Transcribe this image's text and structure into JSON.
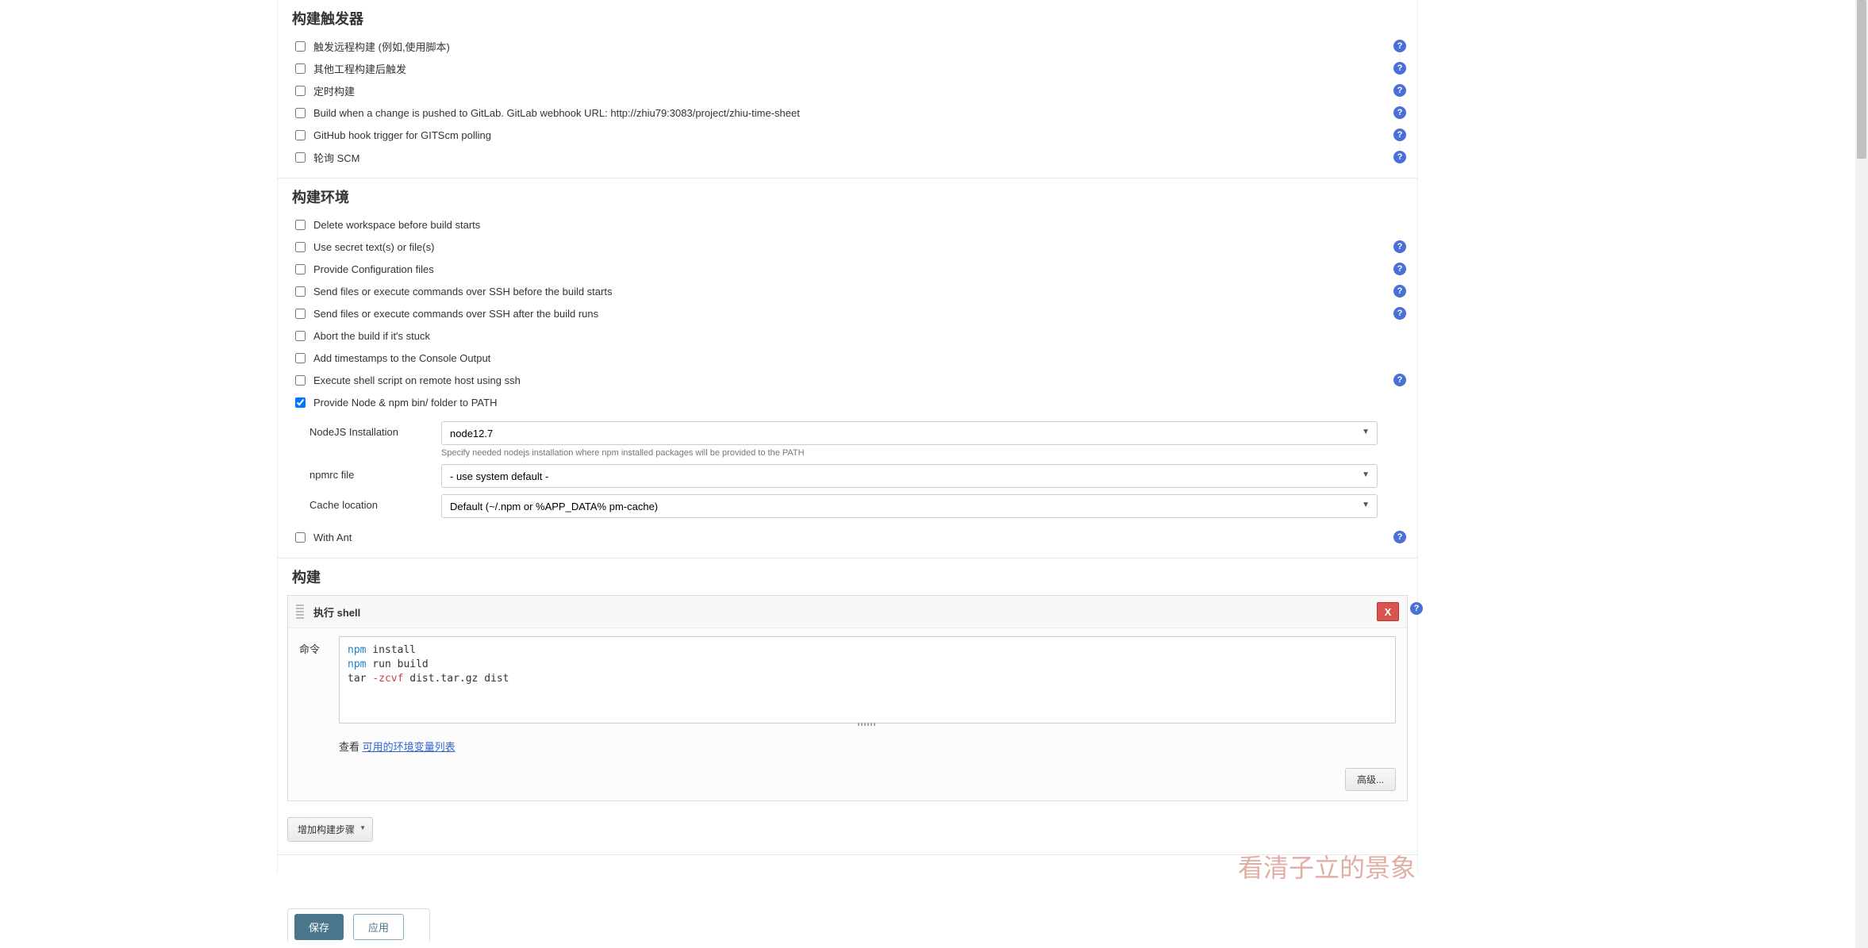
{
  "sections": {
    "triggers_title": "构建触发器",
    "env_title": "构建环境",
    "build_title": "构建"
  },
  "triggers": [
    {
      "label": "触发远程构建 (例如,使用脚本)",
      "help": true
    },
    {
      "label": "其他工程构建后触发",
      "help": true
    },
    {
      "label": "定时构建",
      "help": true
    },
    {
      "label": "Build when a change is pushed to GitLab. GitLab webhook URL: http://zhiu79:3083/project/zhiu-time-sheet",
      "help": true
    },
    {
      "label": "GitHub hook trigger for GITScm polling",
      "help": true
    },
    {
      "label": "轮询 SCM",
      "help": true
    }
  ],
  "env": [
    {
      "label": "Delete workspace before build starts",
      "help": false,
      "checked": false
    },
    {
      "label": "Use secret text(s) or file(s)",
      "help": true,
      "checked": false
    },
    {
      "label": "Provide Configuration files",
      "help": true,
      "checked": false
    },
    {
      "label": "Send files or execute commands over SSH before the build starts",
      "help": true,
      "checked": false
    },
    {
      "label": "Send files or execute commands over SSH after the build runs",
      "help": true,
      "checked": false
    },
    {
      "label": "Abort the build if it's stuck",
      "help": false,
      "checked": false
    },
    {
      "label": "Add timestamps to the Console Output",
      "help": false,
      "checked": false
    },
    {
      "label": "Execute shell script on remote host using ssh",
      "help": true,
      "checked": false
    },
    {
      "label": "Provide Node & npm bin/ folder to PATH",
      "help": false,
      "checked": true
    }
  ],
  "node": {
    "install_label": "NodeJS Installation",
    "install_value": "node12.7",
    "install_hint": "Specify needed nodejs installation where npm installed packages will be provided to the PATH",
    "npmrc_label": "npmrc file",
    "npmrc_value": "- use system default -",
    "cache_label": "Cache location",
    "cache_value": "Default (~/.npm or %APP_DATA% pm-cache)"
  },
  "with_ant": {
    "label": "With Ant",
    "help": true
  },
  "build_step": {
    "title": "执行 shell",
    "remove": "X",
    "cmd_label": "命令",
    "look_label": "查看 ",
    "env_link": "可用的环境变量列表",
    "advanced": "高级..."
  },
  "shell": {
    "line1_cmd": "npm",
    "line1_rest": " install",
    "line2_cmd": "npm",
    "line2_rest": " run build",
    "line3_pre": "tar ",
    "line3_flag": "-zcvf",
    "line3_rest": " dist.tar.gz dist"
  },
  "add_step": "增加构建步骤",
  "footer": {
    "save": "保存",
    "apply": "应用"
  },
  "watermark": "看清子立的景象"
}
